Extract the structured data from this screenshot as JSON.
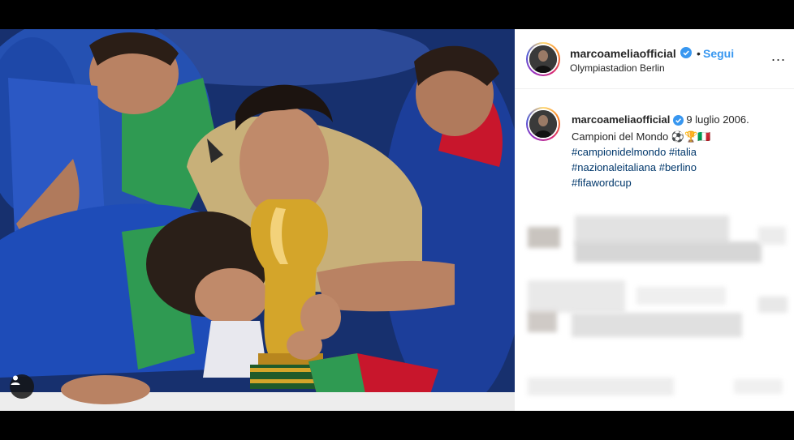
{
  "post": {
    "username": "marcoameliaofficial",
    "follow_label": "Segui",
    "dot": "•",
    "location": "Olympiastadion Berlin",
    "more_label": "..."
  },
  "caption": {
    "username": "marcoameliaofficial",
    "date_text": "9 luglio 2006.",
    "text": "Campioni del Mondo ⚽🏆🇮🇹",
    "hashtags": [
      "#campionidelmondo",
      "#italia",
      "#nazionaleitaliana",
      "#berlino",
      "#fifawordcup"
    ]
  },
  "colors": {
    "follow": "#3897f0",
    "hashtag": "#00376b",
    "verified": "#3897f0"
  },
  "icons": {
    "verified": "verified-badge-icon",
    "more": "more-options-icon",
    "tag": "user-tag-icon"
  }
}
